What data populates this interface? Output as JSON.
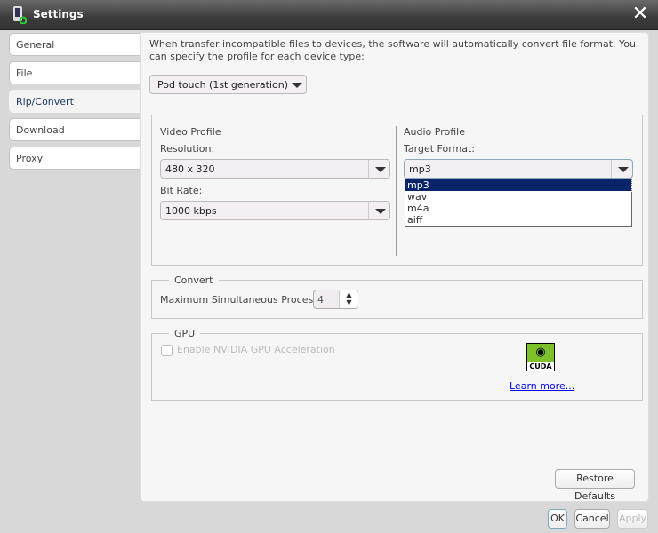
{
  "window": {
    "title": "Settings"
  },
  "tabs": [
    {
      "label": "General"
    },
    {
      "label": "File"
    },
    {
      "label": "Rip/Convert"
    },
    {
      "label": "Download"
    },
    {
      "label": "Proxy"
    }
  ],
  "intro": "When transfer incompatible files to devices, the software will automatically convert file format. You can specify the profile for each device type:",
  "device": {
    "value": "iPod touch (1st generation)"
  },
  "video": {
    "title": "Video Profile",
    "resolution_label": "Resolution:",
    "resolution": "480 x 320",
    "bitrate_label": "Bit Rate:",
    "bitrate": "1000 kbps"
  },
  "audio": {
    "title": "Audio Profile",
    "format_label": "Target Format:",
    "format": "mp3",
    "options": [
      "mp3",
      "wav",
      "m4a",
      "aiff"
    ]
  },
  "convert": {
    "title": "Convert",
    "label": "Maximum Simultaneous Processes:",
    "value": "4"
  },
  "gpu": {
    "title": "GPU",
    "checkbox": "Enable NVIDIA GPU Acceleration",
    "logo_text": "CUDA",
    "link": "Learn more..."
  },
  "buttons": {
    "restore": "Restore Defaults",
    "ok": "OK",
    "cancel": "Cancel",
    "apply": "Apply"
  }
}
